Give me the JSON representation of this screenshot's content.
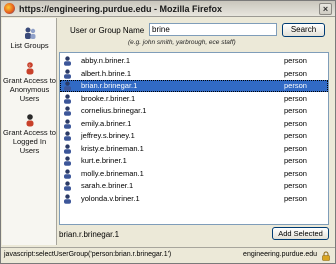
{
  "window": {
    "title": "https://engineering.purdue.edu - Mozilla Firefox",
    "icon": "firefox-icon"
  },
  "sidebar": {
    "items": [
      {
        "label": "List Groups",
        "icon": "group-icon"
      },
      {
        "label": "Grant Access to Anonymous Users",
        "icon": "anonymous-users-icon"
      },
      {
        "label": "Grant Access to Logged In Users",
        "icon": "logged-in-users-icon"
      }
    ]
  },
  "search": {
    "label": "User or Group Name",
    "value": "brine",
    "button_label": "Search",
    "hint": "(e.g. john smith, yarbrough, ece staff)"
  },
  "results": [
    {
      "name": "abby.n.briner.1",
      "type": "person",
      "selected": false
    },
    {
      "name": "albert.h.brine.1",
      "type": "person",
      "selected": false
    },
    {
      "name": "brian.r.brinegar.1",
      "type": "person",
      "selected": true
    },
    {
      "name": "brooke.r.briner.1",
      "type": "person",
      "selected": false
    },
    {
      "name": "cornelius.brinegar.1",
      "type": "person",
      "selected": false
    },
    {
      "name": "emily.a.briner.1",
      "type": "person",
      "selected": false
    },
    {
      "name": "jeffrey.s.briney.1",
      "type": "person",
      "selected": false
    },
    {
      "name": "kristy.e.brineman.1",
      "type": "person",
      "selected": false
    },
    {
      "name": "kurt.e.briner.1",
      "type": "person",
      "selected": false
    },
    {
      "name": "molly.e.brineman.1",
      "type": "person",
      "selected": false
    },
    {
      "name": "sarah.e.briner.1",
      "type": "person",
      "selected": false
    },
    {
      "name": "yolonda.v.briner.1",
      "type": "person",
      "selected": false
    }
  ],
  "selection": {
    "value": "brian.r.brinegar.1",
    "add_button_label": "Add Selected"
  },
  "status": {
    "left": "javascript:selectUserGroup('person:brian.r.brinegar.1')",
    "right": "engineering.purdue.edu",
    "icon": "lock-icon"
  },
  "colors": {
    "selection": "#316ac5",
    "window_bg": "#ece9d8"
  }
}
